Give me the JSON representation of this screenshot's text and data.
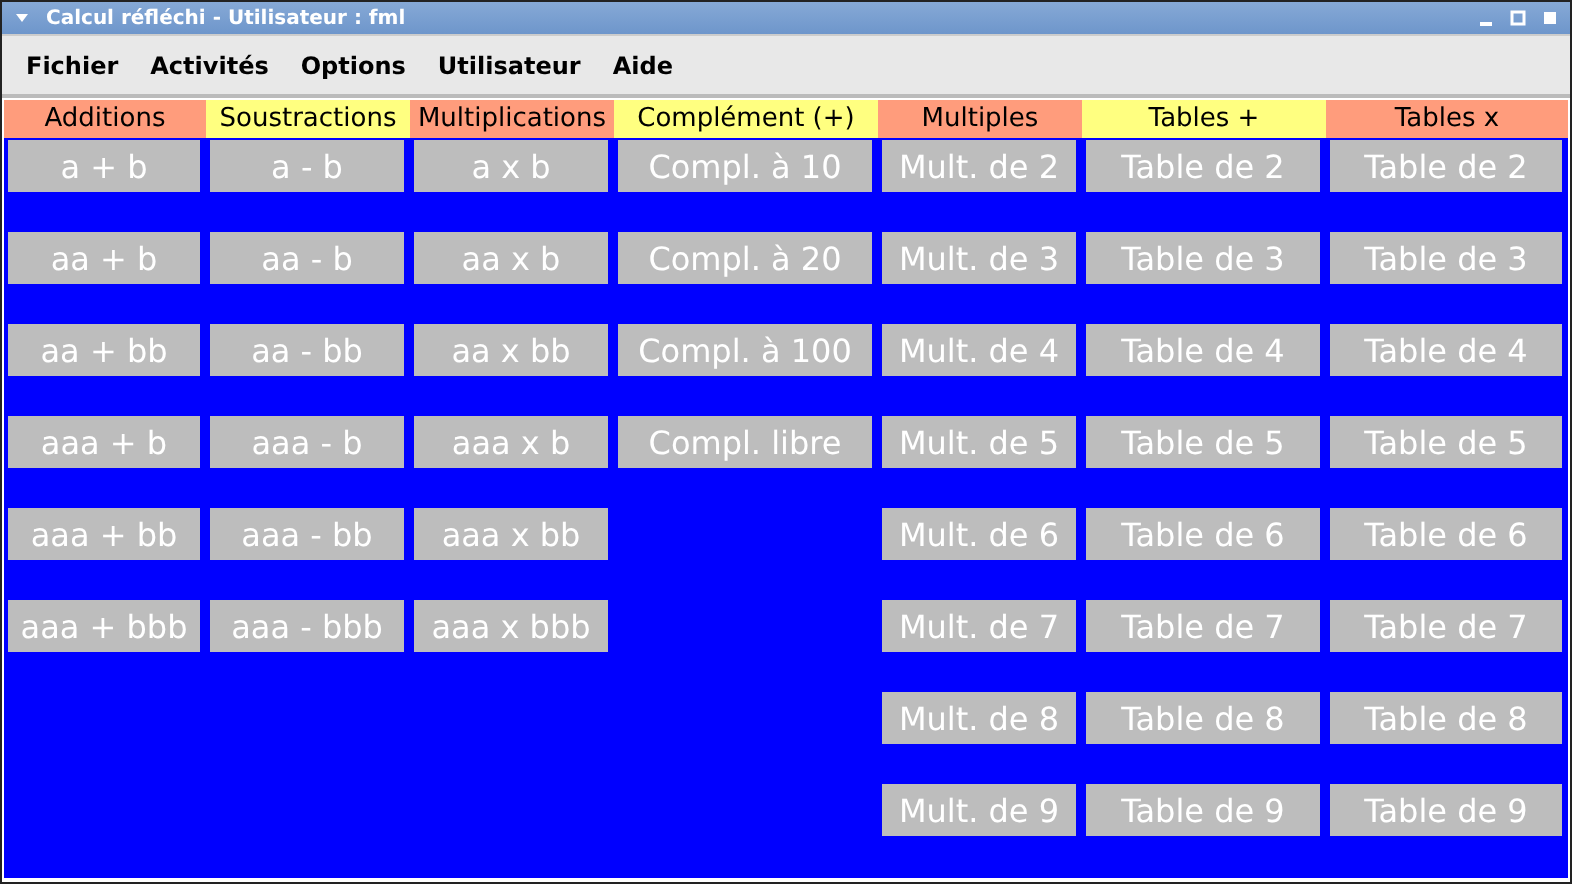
{
  "window": {
    "title": "Calcul réfléchi - Utilisateur : fml"
  },
  "menu": [
    "Fichier",
    "Activités",
    "Options",
    "Utilisateur",
    "Aide"
  ],
  "columns": [
    {
      "header": "Additions",
      "color": "#ff9c7c",
      "buttons": [
        "a + b",
        "aa + b",
        "aa + bb",
        "aaa + b",
        "aaa + bb",
        "aaa + bbb"
      ]
    },
    {
      "header": "Soustractions",
      "color": "#ffff80",
      "buttons": [
        "a - b",
        "aa - b",
        "aa - bb",
        "aaa - b",
        "aaa - bb",
        "aaa - bbb"
      ]
    },
    {
      "header": "Multiplications",
      "color": "#ff9c7c",
      "buttons": [
        "a x b",
        "aa x b",
        "aa x bb",
        "aaa x b",
        "aaa x bb",
        "aaa x bbb"
      ]
    },
    {
      "header": "Complément (+)",
      "color": "#ffff80",
      "buttons": [
        "Compl. à 10",
        "Compl. à 20",
        "Compl. à 100",
        "Compl. libre"
      ]
    },
    {
      "header": "Multiples",
      "color": "#ff9c7c",
      "buttons": [
        "Mult. de 2",
        "Mult. de 3",
        "Mult. de 4",
        "Mult. de 5",
        "Mult. de 6",
        "Mult. de 7",
        "Mult. de 8",
        "Mult. de 9"
      ]
    },
    {
      "header": "Tables +",
      "color": "#ffff80",
      "buttons": [
        "Table de 2",
        "Table de 3",
        "Table de 4",
        "Table de 5",
        "Table de 6",
        "Table de 7",
        "Table de 8",
        "Table de 9"
      ]
    },
    {
      "header": "Tables x",
      "color": "#ff9c7c",
      "buttons": [
        "Table de 2",
        "Table de 3",
        "Table de 4",
        "Table de 5",
        "Table de 6",
        "Table de 7",
        "Table de 8",
        "Table de 9"
      ]
    }
  ]
}
